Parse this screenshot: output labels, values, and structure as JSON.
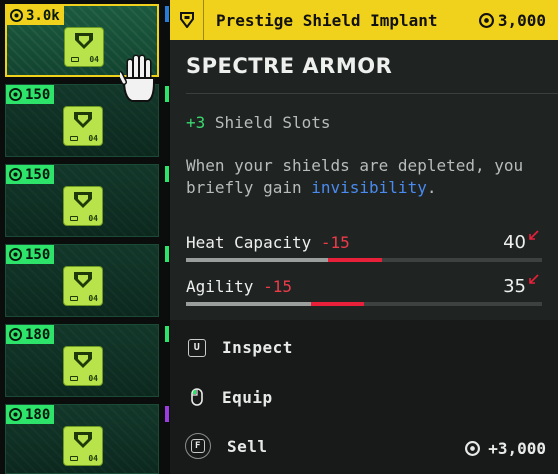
{
  "inventory": {
    "tiles": [
      {
        "price": "3.0k",
        "chip_number": "04",
        "selected": true
      },
      {
        "price": "150",
        "chip_number": "04",
        "selected": false
      },
      {
        "price": "150",
        "chip_number": "04",
        "selected": false
      },
      {
        "price": "150",
        "chip_number": "04",
        "selected": false
      },
      {
        "price": "180",
        "chip_number": "04",
        "selected": false
      },
      {
        "price": "180",
        "chip_number": "04",
        "selected": false
      }
    ],
    "edge_colors": [
      "#2a7ad8",
      "#2de36a",
      "#2de36a",
      "#2de36a",
      "#2de36a",
      "#9a3ce0"
    ],
    "cursor_icon": "hand-cursor-icon"
  },
  "item": {
    "type": "Prestige Shield Implant",
    "header_price": "3,000",
    "name": "SPECTRE ARMOR",
    "bonus_value": "+3",
    "bonus_label": "Shield Slots",
    "desc_before": "When your shields are depleted, you briefly gain ",
    "desc_keyword": "invisibility",
    "desc_after": ".",
    "stats": [
      {
        "label": "Heat Capacity",
        "delta": "-15",
        "value": "40",
        "fill_after": 0.4,
        "fill_before": 0.55
      },
      {
        "label": "Agility",
        "delta": "-15",
        "value": "35",
        "fill_after": 0.35,
        "fill_before": 0.5
      }
    ]
  },
  "actions": {
    "inspect": {
      "key": "U",
      "label": "Inspect"
    },
    "equip": {
      "key_icon": "mouse-left-click-icon",
      "label": "Equip"
    },
    "sell": {
      "key": "F",
      "label": "Sell",
      "price": "+3,000"
    }
  },
  "colors": {
    "accent_yellow": "#f0d21c",
    "price_green": "#2de36a",
    "negative_red": "#e8203a",
    "keyword_blue": "#4a8bf0"
  }
}
